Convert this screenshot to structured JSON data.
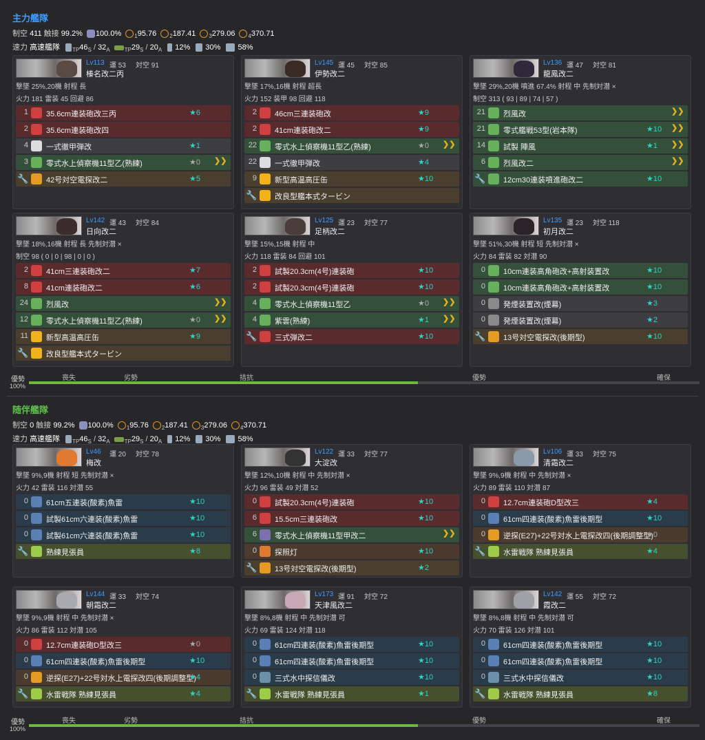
{
  "fleets": [
    {
      "title": "主力艦隊",
      "sum1": [
        "制空",
        "411",
        "触接",
        "99.2%",
        "100.0%",
        "1",
        "95.76",
        "2",
        "187.41",
        "3",
        "279.06",
        "4",
        "370.71"
      ],
      "sum2": [
        "速力",
        "高速艦隊",
        "TP",
        "46",
        "S",
        "/",
        "32",
        "A",
        "TP",
        "29",
        "S",
        "/",
        "20",
        "A",
        "12%",
        "30%",
        "58%"
      ],
      "gauge": {
        "label": "優勢",
        "pct": "100%",
        "ticks": [
          "喪失",
          "劣勢",
          "拮抗",
          "優勢",
          "確保"
        ],
        "fill": 0.58
      },
      "ships": [
        {
          "lv": "Lv113",
          "luck": "運 53",
          "aa": "対空 91",
          "name": "榛名改二丙",
          "s1": "撃墜 25%,20機  射程 長",
          "s2": "火力 181  雷装 45  回避 86",
          "s3": "",
          "slots": [
            [
              "1",
              "35.6cm連装砲改三丙",
              "★6",
              "red",
              "red",
              ""
            ],
            [
              "2",
              "35.6cm連装砲改四",
              "",
              "red",
              "red",
              ""
            ],
            [
              "4",
              "一式徹甲弾改",
              "★1",
              "gray",
              "white",
              ""
            ],
            [
              "3",
              "零式水上偵察機11型乙(熟練)",
              "★0",
              "green",
              "green",
              "›"
            ],
            [
              "",
              "42号対空電探改二",
              "★5",
              "brown",
              "orange",
              ""
            ]
          ]
        },
        {
          "lv": "Lv145",
          "luck": "運 45",
          "aa": "対空 85",
          "name": "伊勢改二",
          "s1": "撃墜 17%,16機  射程 超長",
          "s2": "火力 152  装甲 98  回避 118",
          "s3": "",
          "slots": [
            [
              "2",
              "46cm三連装砲改",
              "★9",
              "red",
              "red",
              ""
            ],
            [
              "2",
              "41cm連装砲改二",
              "★9",
              "red",
              "red",
              ""
            ],
            [
              "22",
              "零式水上偵察機11型乙(熟練)",
              "★0",
              "green",
              "green",
              "›"
            ],
            [
              "22",
              "一式徹甲弾改",
              "★4",
              "gray",
              "white",
              ""
            ],
            [
              "9",
              "新型高温高圧缶",
              "★10",
              "brown",
              "yellow",
              ""
            ],
            [
              "",
              "改良型艦本式タービン",
              "",
              "brown",
              "yellow",
              ""
            ]
          ]
        },
        {
          "lv": "Lv136",
          "luck": "運 47",
          "aa": "対空 81",
          "name": "龍鳳改二",
          "s1": "撃墜 29%,20機  噴進 67.4%  射程 中  先制対潜 ×",
          "s2": "制空 313 ( 93 | 89 | 74 | 57 )",
          "s3": "",
          "slots": [
            [
              "21",
              "烈風改",
              "",
              "green",
              "green",
              "›"
            ],
            [
              "21",
              "零式艦戦53型(岩本隊)",
              "★10",
              "green",
              "green",
              "›"
            ],
            [
              "14",
              "試製 陣風",
              "★1",
              "green",
              "green",
              "›"
            ],
            [
              "6",
              "烈風改二",
              "",
              "green",
              "green",
              "›"
            ],
            [
              "",
              "12cm30連装噴進砲改二",
              "★10",
              "green",
              "green",
              ""
            ]
          ]
        },
        {
          "lv": "Lv142",
          "luck": "運 43",
          "aa": "対空 84",
          "name": "日向改二",
          "s1": "撃墜 18%,16機  射程 長  先制対潜 ×",
          "s2": "制空 98 ( 0 | 0 | 98 | 0 | 0 )",
          "s3": "",
          "slots": [
            [
              "2",
              "41cm三連装砲改二",
              "★7",
              "red",
              "red",
              ""
            ],
            [
              "8",
              "41cm連装砲改二",
              "★6",
              "red",
              "red",
              ""
            ],
            [
              "24",
              "烈風改",
              "",
              "green",
              "green",
              "›"
            ],
            [
              "12",
              "零式水上偵察機11型乙(熟練)",
              "★0",
              "green",
              "green",
              "›"
            ],
            [
              "11",
              "新型高温高圧缶",
              "★9",
              "brown",
              "yellow",
              ""
            ],
            [
              "",
              "改良型艦本式タービン",
              "",
              "brown",
              "yellow",
              ""
            ]
          ]
        },
        {
          "lv": "Lv125",
          "luck": "運 23",
          "aa": "対空 77",
          "name": "足柄改二",
          "s1": "撃墜 15%,15機  射程 中",
          "s2": "火力 118  雷装 84  回避 101",
          "s3": "",
          "slots": [
            [
              "2",
              "試製20.3cm(4号)連装砲",
              "★10",
              "red",
              "red",
              ""
            ],
            [
              "2",
              "試製20.3cm(4号)連装砲",
              "★10",
              "red",
              "red",
              ""
            ],
            [
              "4",
              "零式水上偵察機11型乙",
              "★0",
              "green",
              "green",
              "›"
            ],
            [
              "4",
              "紫雲(熟練)",
              "★1",
              "green",
              "green",
              "›"
            ],
            [
              "",
              "三式弾改二",
              "★10",
              "red",
              "red",
              ""
            ]
          ]
        },
        {
          "lv": "Lv135",
          "luck": "運 23",
          "aa": "対空 118",
          "name": "初月改二",
          "s1": "撃墜 51%,30機  射程 短  先制対潜 ×",
          "s2": "火力 84  雷装 82  対潜 90",
          "s3": "",
          "slots": [
            [
              "0",
              "10cm連装高角砲改+高射装置改",
              "★10",
              "green",
              "green",
              ""
            ],
            [
              "0",
              "10cm連装高角砲改+高射装置改",
              "★10",
              "green",
              "green",
              ""
            ],
            [
              "0",
              "発煙装置改(煙幕)",
              "★3",
              "gray",
              "gray",
              ""
            ],
            [
              "0",
              "発煙装置改(煙幕)",
              "★2",
              "gray",
              "gray",
              ""
            ],
            [
              "",
              "13号対空電探改(後期型)",
              "★10",
              "brown",
              "orange",
              ""
            ]
          ]
        }
      ]
    },
    {
      "title": "随伴艦隊",
      "sum1": [
        "制空",
        "0",
        "触接",
        "99.2%",
        "100.0%",
        "1",
        "95.76",
        "2",
        "187.41",
        "3",
        "279.06",
        "4",
        "370.71"
      ],
      "sum2": [
        "速力",
        "高速艦隊",
        "TP",
        "46",
        "S",
        "/",
        "32",
        "A",
        "TP",
        "29",
        "S",
        "/",
        "20",
        "A",
        "12%",
        "30%",
        "58%"
      ],
      "gauge": {
        "label": "優勢",
        "pct": "100%",
        "ticks": [
          "喪失",
          "劣勢",
          "拮抗",
          "優勢",
          "確保"
        ],
        "fill": 0.58
      },
      "ships": [
        {
          "lv": "Lv46",
          "luck": "運 20",
          "aa": "対空 78",
          "name": "梅改",
          "s1": "撃墜 9%,9機  射程 短  先制対潜 ×",
          "s2": "火力 42  雷装 116  対潜 55",
          "s3": "",
          "slots": [
            [
              "0",
              "61cm五連装(酸素)魚雷",
              "★10",
              "blue",
              "blue",
              ""
            ],
            [
              "0",
              "試製61cm六連装(酸素)魚雷",
              "★10",
              "blue",
              "blue",
              ""
            ],
            [
              "0",
              "試製61cm六連装(酸素)魚雷",
              "★10",
              "blue",
              "blue",
              ""
            ],
            [
              "",
              "熟練見張員",
              "★8",
              "olive",
              "lime",
              ""
            ]
          ]
        },
        {
          "lv": "Lv122",
          "luck": "運 33",
          "aa": "対空 77",
          "name": "大淀改",
          "s1": "撃墜 12%,10機  射程 中  先制対潜 ×",
          "s2": "火力 96  雷装 49  対潜 52",
          "s3": "",
          "slots": [
            [
              "0",
              "試製20.3cm(4号)連装砲",
              "★10",
              "red",
              "red",
              ""
            ],
            [
              "6",
              "15.5cm三連装砲改",
              "★10",
              "red",
              "red",
              ""
            ],
            [
              "6",
              "零式水上偵察機11型甲改二",
              "",
              "green",
              "purple",
              "›"
            ],
            [
              "0",
              "探照灯",
              "★10",
              "tan",
              "tan",
              ""
            ],
            [
              "",
              "13号対空電探改(後期型)",
              "★2",
              "brown",
              "orange",
              ""
            ]
          ]
        },
        {
          "lv": "Lv106",
          "luck": "運 33",
          "aa": "対空 75",
          "name": "清霜改二",
          "s1": "撃墜 9%,9機  射程 中  先制対潜 ×",
          "s2": "火力 89  雷装 110  対潜 87",
          "s3": "",
          "slots": [
            [
              "0",
              "12.7cm連装砲D型改三",
              "★4",
              "red",
              "red",
              ""
            ],
            [
              "0",
              "61cm四連装(酸素)魚雷後期型",
              "★10",
              "blue",
              "blue",
              ""
            ],
            [
              "0",
              "逆探(E27)+22号対水上電探改四(後期調整型)",
              "★0",
              "tan",
              "orange",
              ""
            ],
            [
              "",
              "水雷戦隊 熟練見張員",
              "★4",
              "olive",
              "lime",
              ""
            ]
          ]
        },
        {
          "lv": "Lv144",
          "luck": "運 33",
          "aa": "対空 74",
          "name": "朝霜改二",
          "s1": "撃墜 9%,9機  射程 中  先制対潜 ×",
          "s2": "火力 86  雷装 112  対潜 105",
          "s3": "",
          "slots": [
            [
              "0",
              "12.7cm連装砲D型改三",
              "★0",
              "red",
              "red",
              ""
            ],
            [
              "0",
              "61cm四連装(酸素)魚雷後期型",
              "★10",
              "blue",
              "blue",
              ""
            ],
            [
              "0",
              "逆探(E27)+22号対水上電探改四(後期調整型)",
              "★4",
              "tan",
              "orange",
              ""
            ],
            [
              "",
              "水雷戦隊 熟練見張員",
              "★4",
              "olive",
              "lime",
              ""
            ]
          ]
        },
        {
          "lv": "Lv173",
          "luck": "運 91",
          "aa": "対空 72",
          "name": "天津風改二",
          "s1": "撃墜 8%,8機  射程 中  先制対潜 可",
          "s2": "火力 69  雷装 124  対潜 118",
          "s3": "",
          "slots": [
            [
              "0",
              "61cm四連装(酸素)魚雷後期型",
              "★10",
              "blue",
              "blue",
              ""
            ],
            [
              "0",
              "61cm四連装(酸素)魚雷後期型",
              "★10",
              "blue",
              "blue",
              ""
            ],
            [
              "0",
              "三式水中探信儀改",
              "★10",
              "blue",
              "teal",
              ""
            ],
            [
              "",
              "水雷戦隊 熟練見張員",
              "★1",
              "olive",
              "lime",
              ""
            ]
          ]
        },
        {
          "lv": "Lv142",
          "luck": "運 55",
          "aa": "対空 72",
          "name": "霞改二",
          "s1": "撃墜 8%,8機  射程 中  先制対潜 可",
          "s2": "火力 70  雷装 126  対潜 101",
          "s3": "",
          "slots": [
            [
              "0",
              "61cm四連装(酸素)魚雷後期型",
              "★10",
              "blue",
              "blue",
              ""
            ],
            [
              "0",
              "61cm四連装(酸素)魚雷後期型",
              "★10",
              "blue",
              "blue",
              ""
            ],
            [
              "0",
              "三式水中探信儀改",
              "★10",
              "blue",
              "teal",
              ""
            ],
            [
              "",
              "水雷戦隊 熟練見張員",
              "★8",
              "olive",
              "lime",
              ""
            ]
          ]
        }
      ]
    }
  ]
}
